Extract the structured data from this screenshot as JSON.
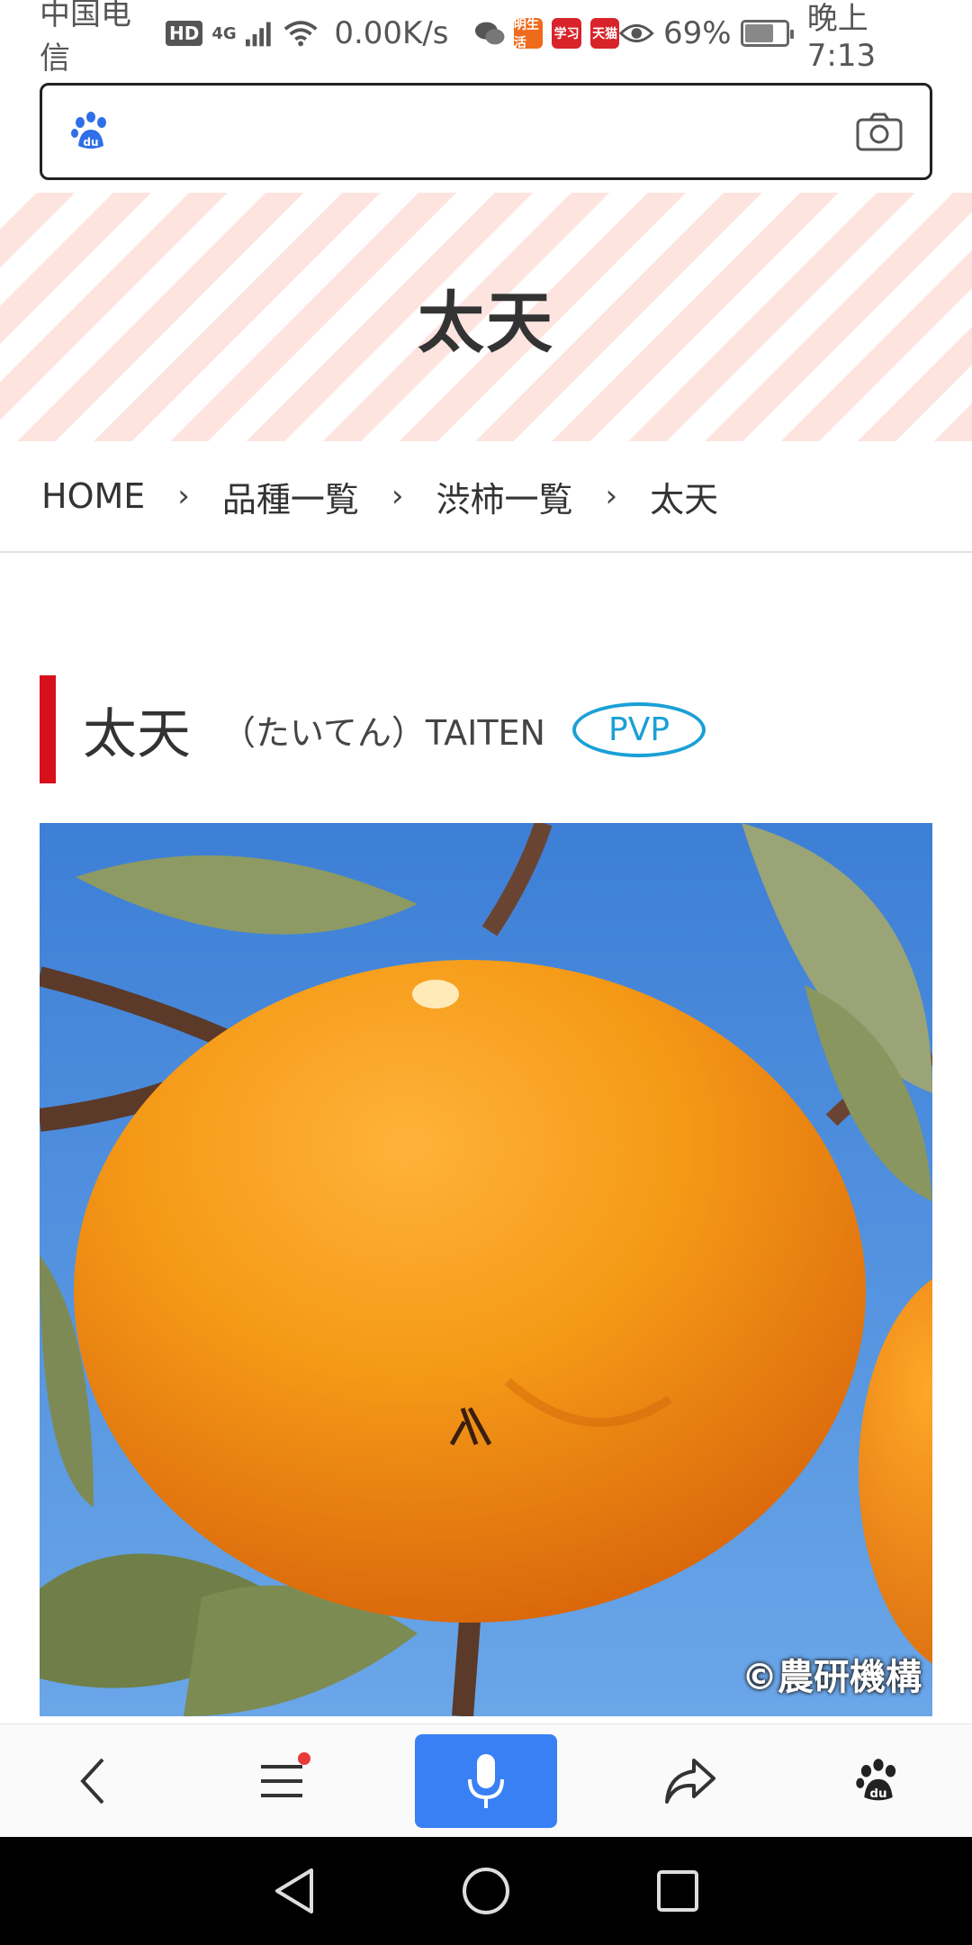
{
  "status_bar": {
    "carrier": "中国电信",
    "hd": "HD",
    "network": "4G",
    "speed": "0.00K/s",
    "app_badges": [
      {
        "label": "明生活",
        "color": "#f06a1d"
      },
      {
        "label": "学习",
        "color": "#d8232a"
      },
      {
        "label": "天猫",
        "color": "#d8232a"
      }
    ],
    "battery_percent": "69%",
    "battery_level": 0.69,
    "time": "晚上7:13"
  },
  "search": {
    "placeholder": "",
    "value": "",
    "logo_icon": "baidu-paw-icon",
    "camera_icon": "camera-icon"
  },
  "hero": {
    "title": "太天"
  },
  "breadcrumb": {
    "items": [
      "HOME",
      "品種一覧",
      "渋柿一覧",
      "太天"
    ],
    "separator": "›"
  },
  "variety": {
    "name": "太天",
    "reading": "（たいてん）TAITEN",
    "badge": "PVP",
    "accent_color": "#d7111c",
    "badge_color": "#1aa0d6"
  },
  "photo": {
    "credit": "©農研機構"
  },
  "toolbar": {
    "back_icon": "back-icon",
    "menu_icon": "menu-icon",
    "mic_icon": "mic-icon",
    "share_icon": "share-icon",
    "home_icon": "baidu-paw-icon",
    "mic_color": "#3a80f5"
  },
  "system_nav": {
    "back": "triangle-back-icon",
    "home": "circle-home-icon",
    "recents": "square-recents-icon"
  }
}
